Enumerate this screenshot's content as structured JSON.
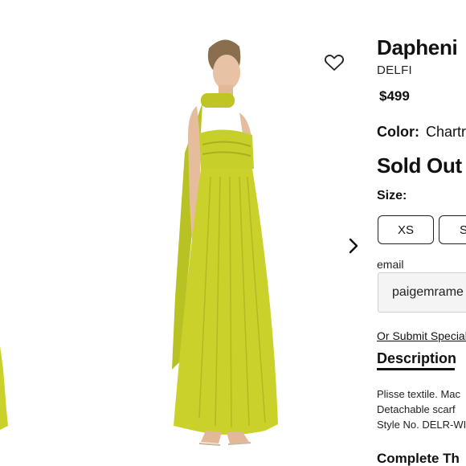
{
  "product": {
    "title": "Dapheni",
    "brand": "DELFI",
    "price": "$499",
    "color_label": "Color:",
    "color_value": "Chartr",
    "stock_status": "Sold Out",
    "size_label": "Size:",
    "sizes": [
      "XS",
      "S"
    ],
    "email_label": "email",
    "email_value": "paigemrame",
    "special_link": "Or Submit Special",
    "description_tab": "Description",
    "description_lines": [
      "Plisse textile. Mac",
      "Detachable scarf",
      "Style No. DELR-WI"
    ],
    "complete_heading": "Complete Th"
  },
  "gallery": {
    "icons": [
      "heart-icon",
      "chevron-right-icon",
      "chevron-left-icon"
    ],
    "dress_color": "#c9d12a"
  }
}
